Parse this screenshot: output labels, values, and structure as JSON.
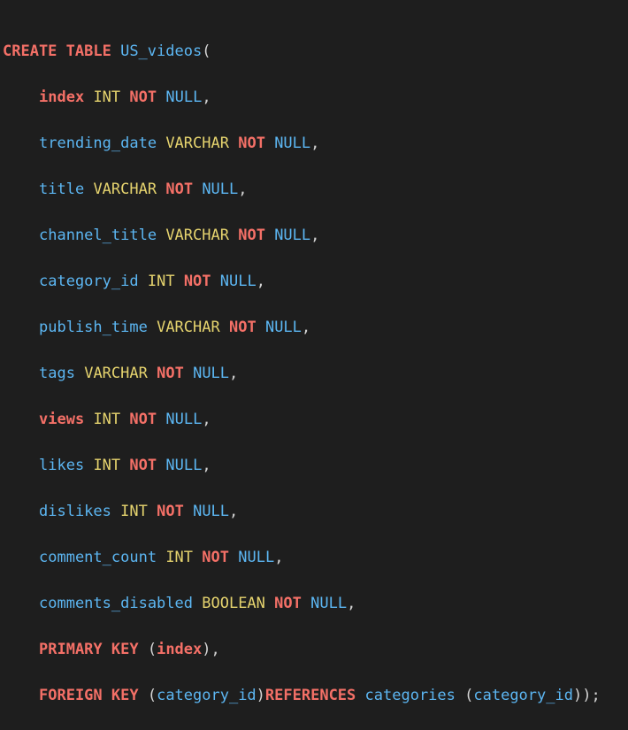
{
  "code": {
    "line1": {
      "kw1": "CREATE TABLE",
      "name": "US_videos",
      "punct": "("
    },
    "columns": [
      {
        "name": "index",
        "type": "INT",
        "not": "NOT",
        "null": "NULL",
        "punct": ","
      },
      {
        "name": "trending_date",
        "type": "VARCHAR",
        "not": "NOT",
        "null": "NULL",
        "punct": ","
      },
      {
        "name": "title",
        "type": "VARCHAR",
        "not": "NOT",
        "null": "NULL",
        "punct": ","
      },
      {
        "name": "channel_title",
        "type": "VARCHAR",
        "not": "NOT",
        "null": "NULL",
        "punct": ","
      },
      {
        "name": "category_id",
        "type": "INT",
        "not": "NOT",
        "null": "NULL",
        "punct": ","
      },
      {
        "name": "publish_time",
        "type": "VARCHAR",
        "not": "NOT",
        "null": "NULL",
        "punct": ","
      },
      {
        "name": "tags",
        "type": "VARCHAR",
        "not": "NOT",
        "null": "NULL",
        "punct": ","
      },
      {
        "name": "views",
        "type": "INT",
        "not": "NOT",
        "null": "NULL",
        "punct": ","
      },
      {
        "name": "likes",
        "type": "INT",
        "not": "NOT",
        "null": "NULL",
        "punct": ","
      },
      {
        "name": "dislikes",
        "type": "INT",
        "not": "NOT",
        "null": "NULL",
        "punct": ","
      },
      {
        "name": "comment_count",
        "type": "INT",
        "not": "NOT",
        "null": "NULL",
        "punct": ","
      },
      {
        "name": "comments_disabled",
        "type": "BOOLEAN",
        "not": "NOT",
        "null": "NULL",
        "punct": ","
      }
    ],
    "primary_key": {
      "kw": "PRIMARY KEY",
      "open": " (",
      "col": "index",
      "close": "),"
    },
    "foreign_key": {
      "kw": "FOREIGN KEY",
      "open": " (",
      "col": "category_id",
      "close": ")",
      "ref_kw": "REFERENCES",
      "ref_table": "categories",
      "ref_open": " (",
      "ref_col": "category_id",
      "ref_close": "));"
    }
  },
  "colors": {
    "background": "#1e1e1e",
    "keyword": "#f47067",
    "type": "#e5d36e",
    "identifier": "#5cb6f2",
    "punctuation": "#d4d4d4"
  }
}
